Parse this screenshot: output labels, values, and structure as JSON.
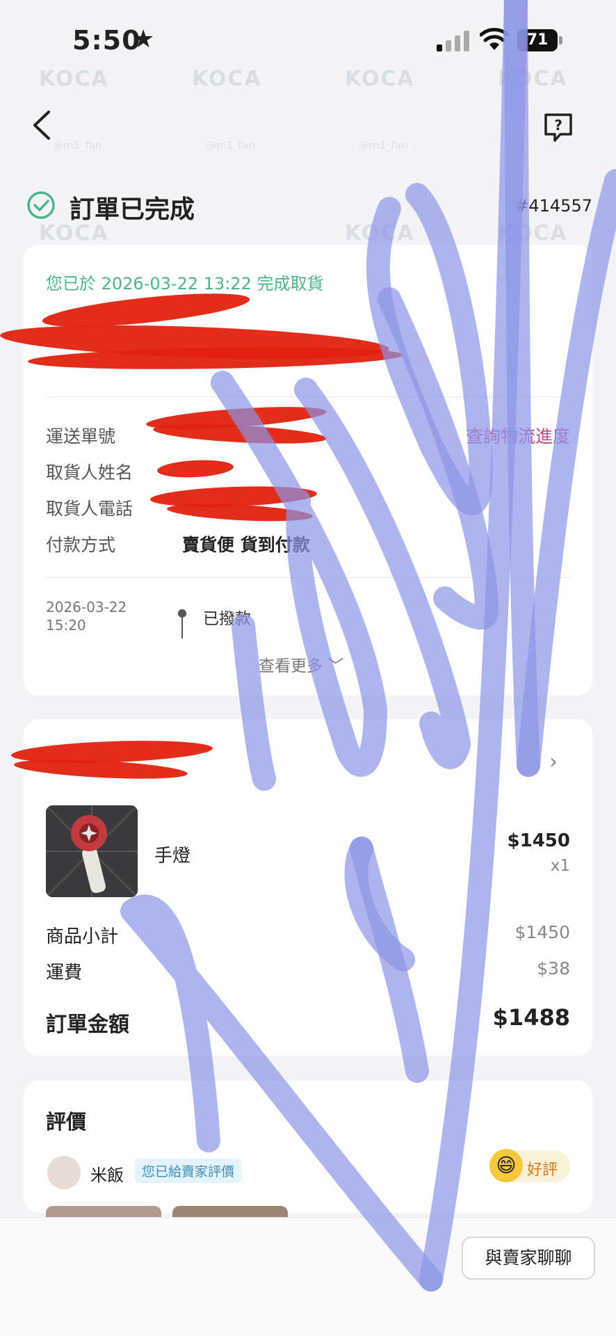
{
  "status_bar": {
    "time": "5:50",
    "star": "★",
    "battery": "71"
  },
  "header": {
    "back_icon": "chevron-left-icon",
    "help_icon": "question-bubble-icon"
  },
  "order": {
    "title": "訂單已完成",
    "number": "#414557"
  },
  "pickup": {
    "note": "您已於 2026-03-22 13:22 完成取貨"
  },
  "details": {
    "tracking_label": "運送單號",
    "tracking_link": "查詢物流進度",
    "receiver_name_label": "取貨人姓名",
    "receiver_phone_label": "取貨人電話",
    "payment_label": "付款方式",
    "payment_value": "賣貨便 貨到付款"
  },
  "timeline": {
    "date": "2026-03-22",
    "time": "15:20",
    "event": "已撥款",
    "see_more": "查看更多 ﹀"
  },
  "item": {
    "name": "手燈",
    "price": "$1450",
    "qty": "x1"
  },
  "summary": {
    "subtotal_label": "商品小計",
    "subtotal_value": "$1450",
    "shipping_label": "運費",
    "shipping_value": "$38",
    "total_label": "訂單金額",
    "total_value": "$1488"
  },
  "review": {
    "title": "評價",
    "reviewer": "米飯",
    "badge": "您已給賣家評價",
    "rating": "好評",
    "rating_emoji": "😄"
  },
  "footer": {
    "chat_button": "與賣家聊聊"
  },
  "watermark": {
    "brand": "KOCA",
    "handle": "@m1_fan"
  },
  "colors": {
    "success": "#4cb48a",
    "link": "#c24a8c",
    "redaction": "#e0220f",
    "scribble": "#8c94e6"
  }
}
